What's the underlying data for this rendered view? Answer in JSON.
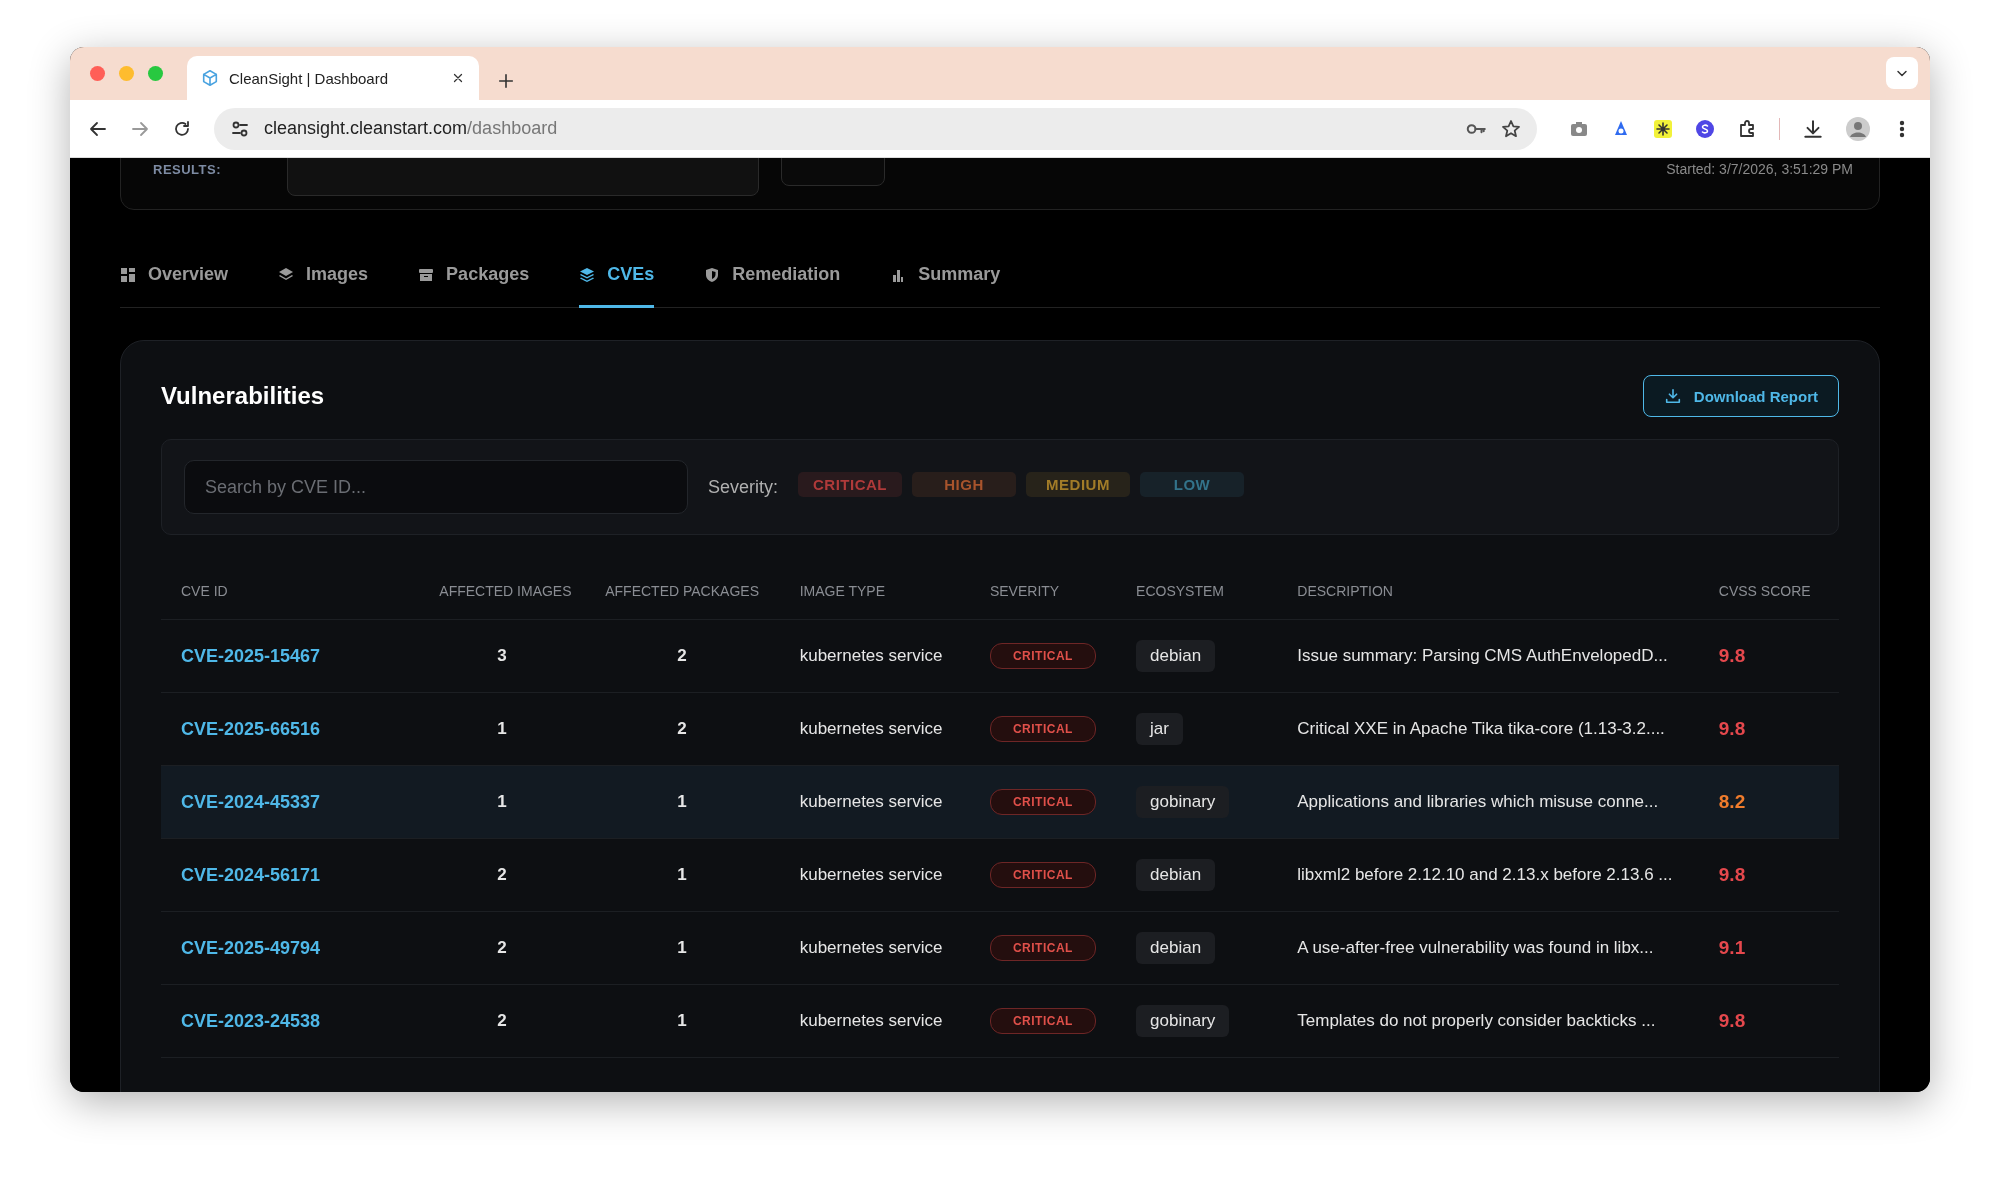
{
  "browser": {
    "tab_title": "CleanSight | Dashboard",
    "url_host": "cleansight.cleanstart.com",
    "url_path": "/dashboard"
  },
  "scan": {
    "results_label": "RESULTS:",
    "started": "Started: 3/7/2026, 3:51:29 PM"
  },
  "tabs": [
    {
      "label": "Overview",
      "selected": false
    },
    {
      "label": "Images",
      "selected": false
    },
    {
      "label": "Packages",
      "selected": false
    },
    {
      "label": "CVEs",
      "selected": true
    },
    {
      "label": "Remediation",
      "selected": false
    },
    {
      "label": "Summary",
      "selected": false
    }
  ],
  "vulnerabilities": {
    "title": "Vulnerabilities",
    "download_button": "Download Report",
    "search": {
      "placeholder": "Search by CVE ID..."
    },
    "severity_label": "Severity:",
    "severity_filters": [
      {
        "label": "CRITICAL",
        "color": "#b03a3a"
      },
      {
        "label": "HIGH",
        "color": "#a8542c"
      },
      {
        "label": "MEDIUM",
        "color": "#a27c28"
      },
      {
        "label": "LOW",
        "color": "#33738a"
      }
    ],
    "table": {
      "columns": [
        "CVE ID",
        "AFFECTED IMAGES",
        "AFFECTED PACKAGES",
        "IMAGE TYPE",
        "SEVERITY",
        "ECOSYSTEM",
        "DESCRIPTION",
        "CVSS SCORE"
      ],
      "rows": [
        {
          "cve_id": "CVE-2025-15467",
          "affected_images": "3",
          "affected_packages": "2",
          "image_type": "kubernetes service",
          "severity": "CRITICAL",
          "ecosystem": "debian",
          "description": "Issue summary: Parsing CMS AuthEnvelopedD...",
          "cvss": "9.8",
          "color": "#e5484d",
          "selected": false
        },
        {
          "cve_id": "CVE-2025-66516",
          "affected_images": "1",
          "affected_packages": "2",
          "image_type": "kubernetes service",
          "severity": "CRITICAL",
          "ecosystem": "jar",
          "description": "Critical XXE in Apache Tika tika-core (1.13-3.2....",
          "cvss": "9.8",
          "color": "#e5484d",
          "selected": false
        },
        {
          "cve_id": "CVE-2024-45337",
          "affected_images": "1",
          "affected_packages": "1",
          "image_type": "kubernetes service",
          "severity": "CRITICAL",
          "ecosystem": "gobinary",
          "description": "Applications and libraries which misuse conne...",
          "cvss": "8.2",
          "color": "#f07c2c",
          "selected": true
        },
        {
          "cve_id": "CVE-2024-56171",
          "affected_images": "2",
          "affected_packages": "1",
          "image_type": "kubernetes service",
          "severity": "CRITICAL",
          "ecosystem": "debian",
          "description": "libxml2 before 2.12.10 and 2.13.x before 2.13.6 ...",
          "cvss": "9.8",
          "color": "#e5484d",
          "selected": false
        },
        {
          "cve_id": "CVE-2025-49794",
          "affected_images": "2",
          "affected_packages": "1",
          "image_type": "kubernetes service",
          "severity": "CRITICAL",
          "ecosystem": "debian",
          "description": "A use-after-free vulnerability was found in libx...",
          "cvss": "9.1",
          "color": "#e5484d",
          "selected": false
        },
        {
          "cve_id": "CVE-2023-24538",
          "affected_images": "2",
          "affected_packages": "1",
          "image_type": "kubernetes service",
          "severity": "CRITICAL",
          "ecosystem": "gobinary",
          "description": "Templates do not properly consider backticks ...",
          "cvss": "9.8",
          "color": "#e5484d",
          "selected": false
        }
      ]
    }
  }
}
